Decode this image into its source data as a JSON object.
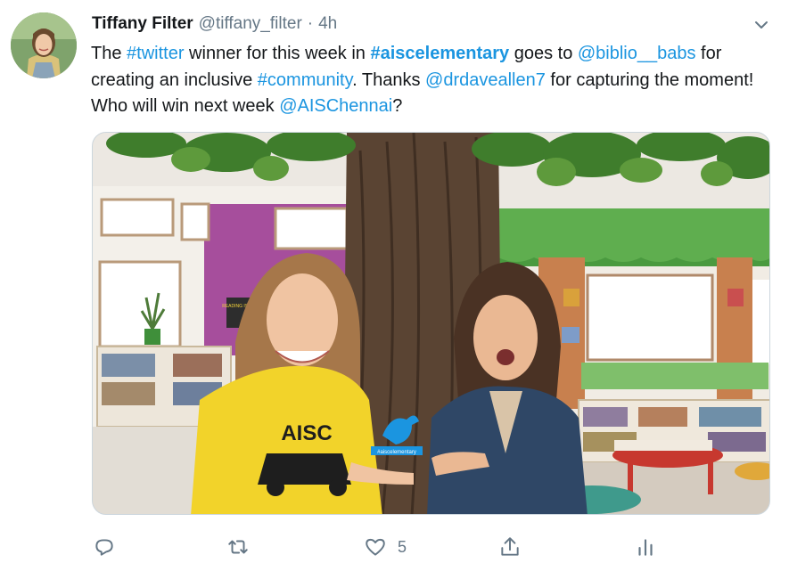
{
  "author": {
    "display_name": "Tiffany Filter",
    "handle": "@tiffany_filter",
    "separator": "·",
    "time": "4h"
  },
  "tweet": {
    "segments": [
      {
        "text": "The ",
        "style": "plain"
      },
      {
        "text": "#twitter",
        "style": "link"
      },
      {
        "text": " winner for this week in ",
        "style": "plain"
      },
      {
        "text": "#aiscelementary",
        "style": "link-bold"
      },
      {
        "text": " goes to ",
        "style": "plain"
      },
      {
        "text": "@biblio__babs",
        "style": "link"
      },
      {
        "text": " for creating an inclusive ",
        "style": "plain"
      },
      {
        "text": "#community",
        "style": "link"
      },
      {
        "text": ". Thanks ",
        "style": "plain"
      },
      {
        "text": "@drdaveallen7",
        "style": "link"
      },
      {
        "text": " for capturing the moment! Who will win next week ",
        "style": "plain"
      },
      {
        "text": "@AISChennai",
        "style": "link"
      },
      {
        "text": "?",
        "style": "plain"
      }
    ]
  },
  "media": {
    "shirt_text": "AISC",
    "trophy_text": "#aiscelementary",
    "poster_text": "READING IS LIT"
  },
  "actions": {
    "reply_icon": "reply-icon",
    "retweet_icon": "retweet-icon",
    "like_icon": "heart-icon",
    "like_count": "5",
    "share_icon": "share-icon",
    "analytics_icon": "analytics-icon"
  },
  "colors": {
    "link": "#1b95e0",
    "text": "#14171a",
    "secondary": "#657786",
    "border": "#ccd6dd"
  }
}
